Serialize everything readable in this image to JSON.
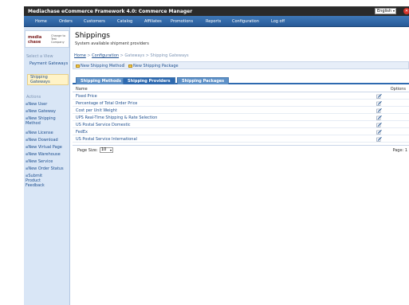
{
  "header": {
    "app_title": "Mediachase eCommerce Framework 4.0: Commerce Manager",
    "language": "English",
    "close_icon": "close-icon"
  },
  "menu": {
    "items": [
      "Home",
      "Orders",
      "Customers",
      "Catalog",
      "Affiliates",
      "Promotions",
      "Reports",
      "Configuration",
      "Log off"
    ]
  },
  "sidebar": {
    "logo_line1": "media",
    "logo_line2": "chase",
    "change_company": "Change to Test Company",
    "select_view_label": "Select a View",
    "views": [
      "Payment Gateways",
      "Shipping Gateways"
    ],
    "actions_label": "Actions",
    "actions": [
      "New User",
      "New Gateway",
      "New Shipping Method",
      "New License",
      "New Download",
      "New Virtual Page",
      "New Warehouse",
      "New Service",
      "New Order Status",
      "Submit Product Feedback"
    ]
  },
  "page": {
    "title": "Shippings",
    "subtitle": "System available shipment providers"
  },
  "breadcrumb": {
    "home": "Home",
    "sep1": " > ",
    "configuration": "Configuration",
    "rest": " > Gateways > Shipping Gateways"
  },
  "toolbar": {
    "new_method": "New Shipping Method",
    "separator": "|",
    "new_package": "New Shipping Package"
  },
  "tabs": [
    "Shipping Methods",
    "Shipping Providers",
    "Shipping Packages"
  ],
  "grid": {
    "col_name": "Name",
    "col_options": "Options",
    "rows": [
      "Fixed Price",
      "Percentage of Total Order Price",
      "Cost per Unit Weight",
      "UPS Real-Time Shipping & Rate Selection",
      "US Postal Service Domestic",
      "FedEx",
      "US Postal Service International"
    ]
  },
  "pager": {
    "page_size_label": "Page Size:",
    "page_size": "10",
    "page_label": "Page: 1"
  },
  "colors": {
    "menubar": "#275a97",
    "topbar": "#2a2a2a",
    "active_tab": "#2e6ab0",
    "sidebar_bg": "#d9e6f6"
  }
}
